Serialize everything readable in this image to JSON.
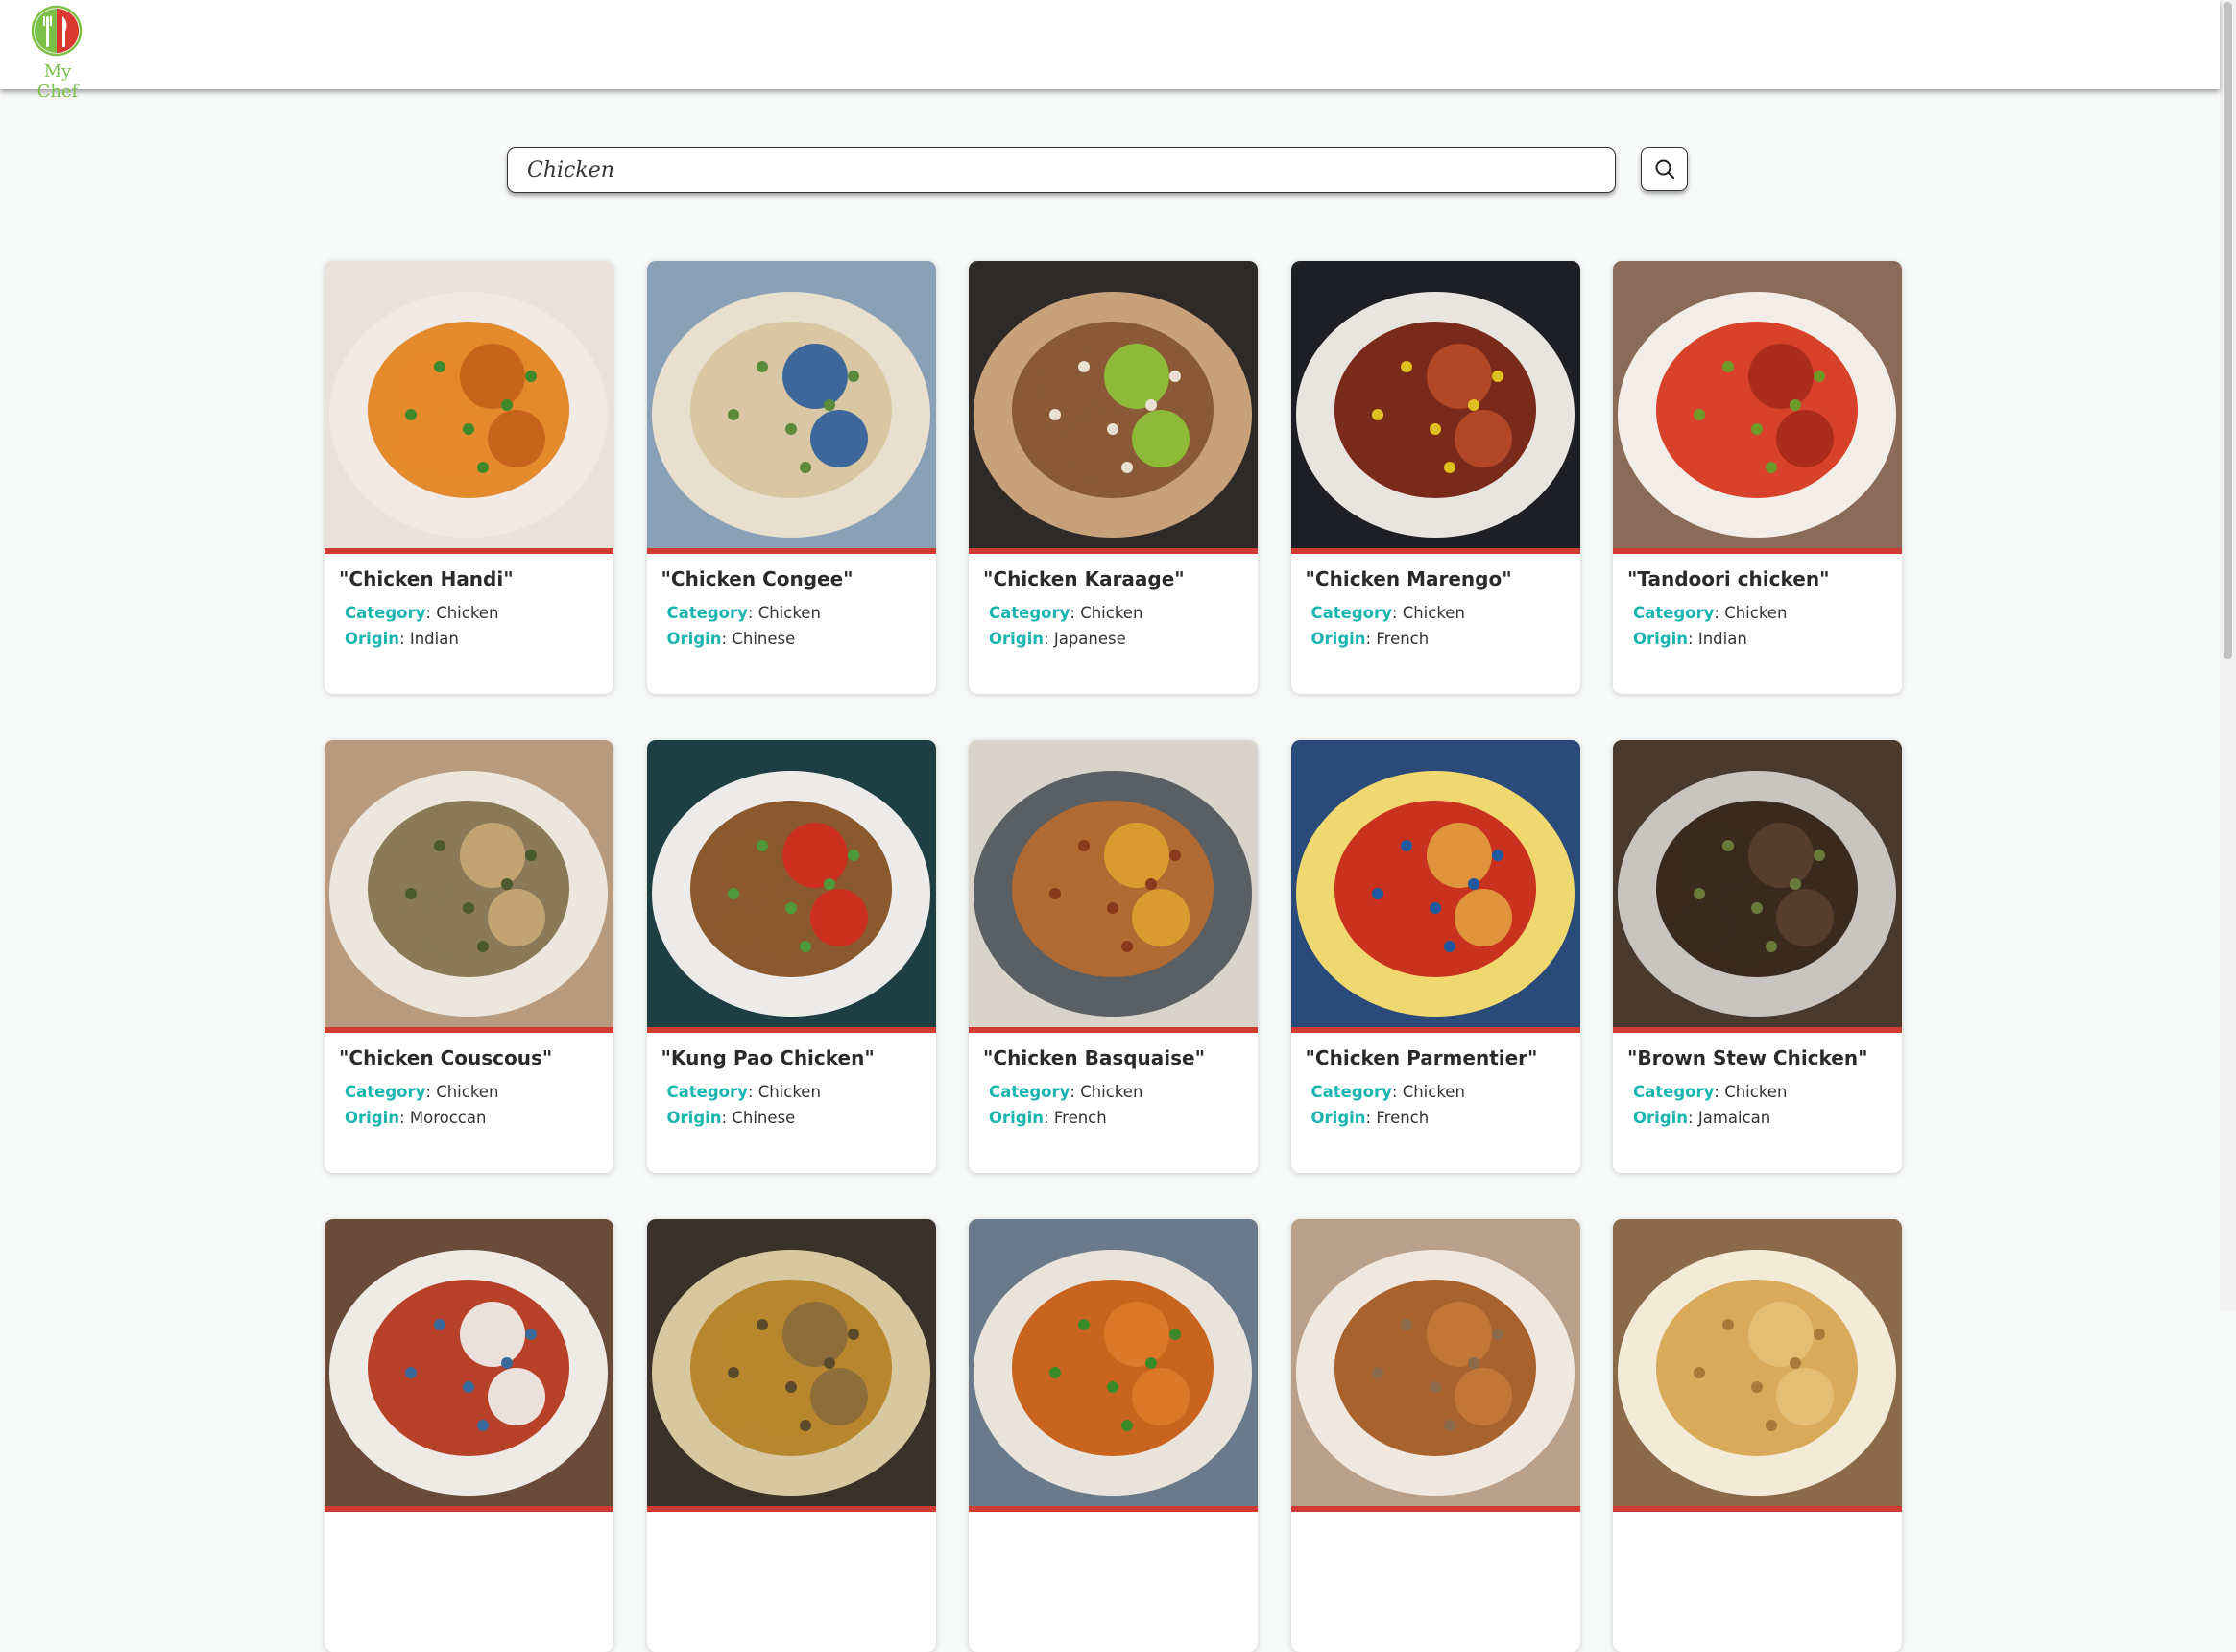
{
  "app": {
    "logo_text": "My Chef"
  },
  "search": {
    "value": "Chicken"
  },
  "colors": {
    "accent": "#1bb5b0",
    "card_bar": "#cf3b32",
    "logo_green": "#7cc04a",
    "logo_red": "#d9392f"
  },
  "meta_labels": {
    "category": "Category",
    "origin": "Origin"
  },
  "recipes": [
    {
      "title": "\"Chicken Handi\"",
      "category": "Chicken",
      "origin": "Indian",
      "palette": [
        "#e9e2dc",
        "#f0e9e4",
        "#e38a2d",
        "#c35f1a",
        "#3e8a2a"
      ]
    },
    {
      "title": "\"Chicken Congee\"",
      "category": "Chicken",
      "origin": "Chinese",
      "palette": [
        "#8aa0b6",
        "#e8dfcf",
        "#d8c7a2",
        "#2d5c9a",
        "#5a8a3a"
      ]
    },
    {
      "title": "\"Chicken Karaage\"",
      "category": "Chicken",
      "origin": "Japanese",
      "palette": [
        "#2d2a27",
        "#c8a07a",
        "#8a5a36",
        "#8fc43a",
        "#e8e0d0"
      ]
    },
    {
      "title": "\"Chicken Marengo\"",
      "category": "Chicken",
      "origin": "French",
      "palette": [
        "#1e1f24",
        "#e8e4df",
        "#7a2a1a",
        "#b84a2a",
        "#e0c020"
      ]
    },
    {
      "title": "\"Tandoori chicken\"",
      "category": "Chicken",
      "origin": "Indian",
      "palette": [
        "#8a6a58",
        "#f2ede6",
        "#d8412a",
        "#a62a1a",
        "#6e9a2a"
      ]
    },
    {
      "title": "\"Chicken Couscous\"",
      "category": "Chicken",
      "origin": "Moroccan",
      "palette": [
        "#b89a7e",
        "#ece6dc",
        "#8a7a58",
        "#c8a876",
        "#4a5a2a"
      ]
    },
    {
      "title": "\"Kung Pao Chicken\"",
      "category": "Chicken",
      "origin": "Chinese",
      "palette": [
        "#1d3e42",
        "#ecebea",
        "#8a5a2e",
        "#d42a1e",
        "#4e9a3a"
      ]
    },
    {
      "title": "\"Chicken Basquaise\"",
      "category": "Chicken",
      "origin": "French",
      "palette": [
        "#d9d4cb",
        "#5a5f64",
        "#b06a32",
        "#e0a030",
        "#8a3a1a"
      ]
    },
    {
      "title": "\"Chicken Parmentier\"",
      "category": "Chicken",
      "origin": "French",
      "palette": [
        "#2a4a7a",
        "#f0d870",
        "#c8321e",
        "#e2a040",
        "#1f5aa0"
      ]
    },
    {
      "title": "\"Brown Stew Chicken\"",
      "category": "Chicken",
      "origin": "Jamaican",
      "palette": [
        "#4a3a2e",
        "#c8c4c0",
        "#3a2a1e",
        "#5a4030",
        "#6a7a3a"
      ]
    },
    {
      "title": "",
      "category": "",
      "origin": "",
      "palette": [
        "#6a4a3a",
        "#eeeae6",
        "#b8412a",
        "#f2f2ee",
        "#3a6a9a"
      ]
    },
    {
      "title": "",
      "category": "",
      "origin": "",
      "palette": [
        "#3a3228",
        "#d8c8a0",
        "#b8862e",
        "#8a6a3a",
        "#5a4a2a"
      ]
    },
    {
      "title": "",
      "category": "",
      "origin": "",
      "palette": [
        "#6a7a8a",
        "#e8e4dc",
        "#c8641e",
        "#e07a2a",
        "#3a8a2a"
      ]
    },
    {
      "title": "",
      "category": "",
      "origin": "",
      "palette": [
        "#b8a08a",
        "#f0e8de",
        "#a8622e",
        "#c47a3a",
        "#8a6a4a"
      ]
    },
    {
      "title": "",
      "category": "",
      "origin": "",
      "palette": [
        "#8a6a4a",
        "#f3ead8",
        "#d8aa5a",
        "#e6c078",
        "#a87a3a"
      ]
    }
  ]
}
